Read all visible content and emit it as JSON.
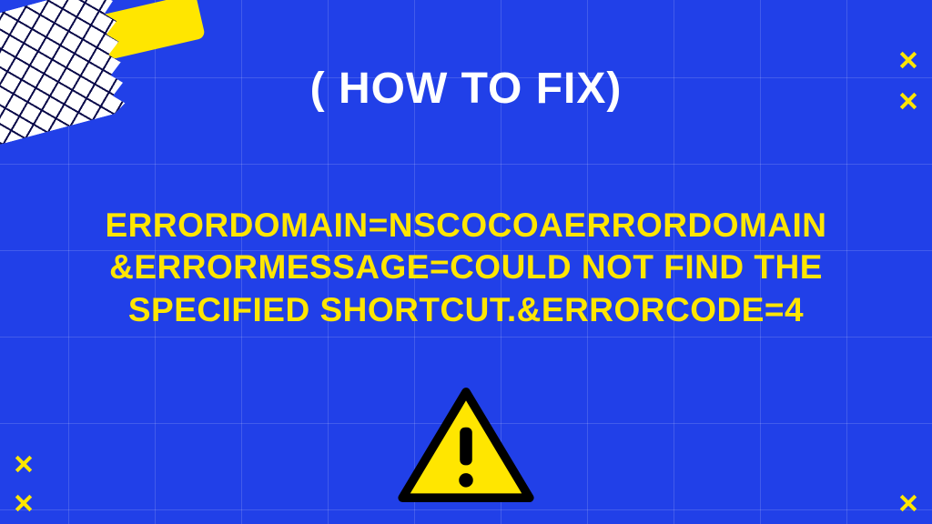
{
  "heading": "( HOW TO FIX)",
  "error_message": "ERRORDOMAIN=NSCOCOAERRORDOMAIN &ERRORMESSAGE=COULD NOT FIND THE SPECIFIED SHORTCUT.&ERRORCODE=4",
  "colors": {
    "background": "#2140e8",
    "accent_yellow": "#ffe600",
    "text_white": "#ffffff"
  },
  "icons": {
    "warning": "warning-triangle"
  }
}
